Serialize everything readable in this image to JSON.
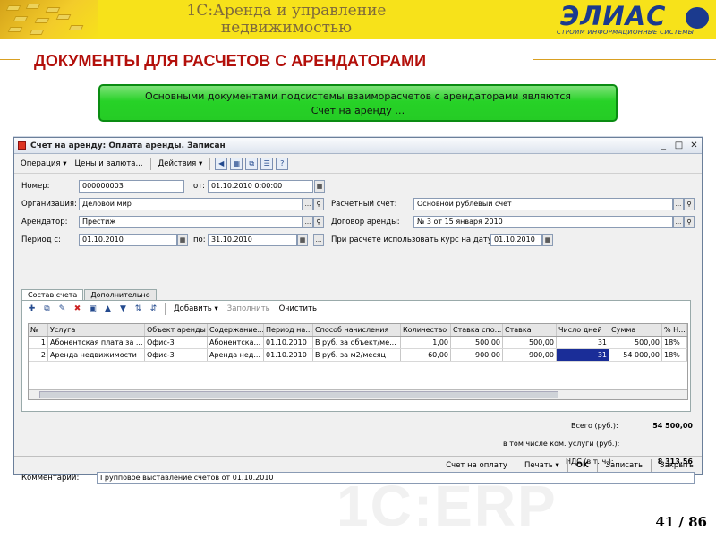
{
  "slide": {
    "header_title_line1": "1С:Аренда и управление",
    "header_title_line2": "недвижимостью",
    "logo_text": "ЭЛИАС",
    "logo_tagline": "СТРОИМ ИНФОРМАЦИОННЫЕ СИСТЕМЫ",
    "heading": "ДОКУМЕНТЫ ДЛЯ РАСЧЕТОВ С АРЕНДАТОРАМИ",
    "info_line1": "Основными документами подсистемы взаиморасчетов с арендаторами являются",
    "info_line2": "Счет на аренду …",
    "page_number": "41 / 86",
    "accent_color": "#f7e21a",
    "heading_color": "#b3100b",
    "info_box_color": "#25cc25"
  },
  "window": {
    "title": "Счет на аренду: Оплата аренды. Записан",
    "controls": [
      "_",
      "□",
      "✕"
    ],
    "toolbar": {
      "operation": "Операция ▾",
      "prices": "Цены и валюта...",
      "actions": "Действия ▾",
      "icons": [
        "back-icon",
        "report-icon",
        "structure-icon",
        "list-icon",
        "help-icon"
      ],
      "help_glyph": "?"
    },
    "form": {
      "number_label": "Номер:",
      "number_value": "000000003",
      "date_label": "от:",
      "date_value": "01.10.2010  0:00:00",
      "org_label": "Организация:",
      "org_value": "Деловой мир",
      "account_label": "Расчетный счет:",
      "account_value": "Основной рублевый счет",
      "tenant_label": "Арендатор:",
      "tenant_value": "Престиж",
      "contract_label": "Договор аренды:",
      "contract_value": "№ 3 от 15 января 2010",
      "period_from_label": "Период с:",
      "period_from_value": "01.10.2010",
      "period_to_label": "по:",
      "period_to_value": "31.10.2010",
      "rate_date_label": "При расчете использовать курс на дату:",
      "rate_date_value": "01.10.2010",
      "dots": "...",
      "search_glyph": "🔍"
    },
    "tabs": [
      "Состав счета",
      "Дополнительно"
    ],
    "grid_toolbar": {
      "add": "Добавить ▾",
      "fill": "Заполнить",
      "clear": "Очистить"
    },
    "grid": {
      "columns": [
        "№",
        "Услуга",
        "Объект аренды",
        "Содержание...",
        "Период на...",
        "Способ начисления",
        "Количество",
        "Ставка спо...",
        "Ставка",
        "Число дней",
        "Сумма",
        "% Н..."
      ],
      "rows": [
        [
          "1",
          "Абонентская плата за ...",
          "Офис-3",
          "Абонентска...",
          "01.10.2010",
          "В руб. за объект/ме...",
          "1,00",
          "500,00",
          "500,00",
          "31",
          "500,00",
          "18%"
        ],
        [
          "2",
          "Аренда недвижимости",
          "Офис-3",
          "Аренда нед...",
          "01.10.2010",
          "В руб. за м2/месяц",
          "60,00",
          "900,00",
          "900,00",
          "31",
          "54 000,00",
          "18%"
        ]
      ]
    },
    "totals": {
      "total_label": "Всего (руб.):",
      "total_value": "54 500,00",
      "incl_label": "в том числе ком. услуги (руб.):",
      "vat_label": "НДС (в т. ч.):",
      "vat_value": "8 313,56"
    },
    "comment_label": "Комментарий:",
    "comment_value": "Групповое выставление счетов от 01.10.2010",
    "footer": {
      "pay_invoice": "Счет на оплату",
      "print": "Печать ▾",
      "ok": "OK",
      "save": "Записать",
      "close": "Закрыть"
    }
  }
}
